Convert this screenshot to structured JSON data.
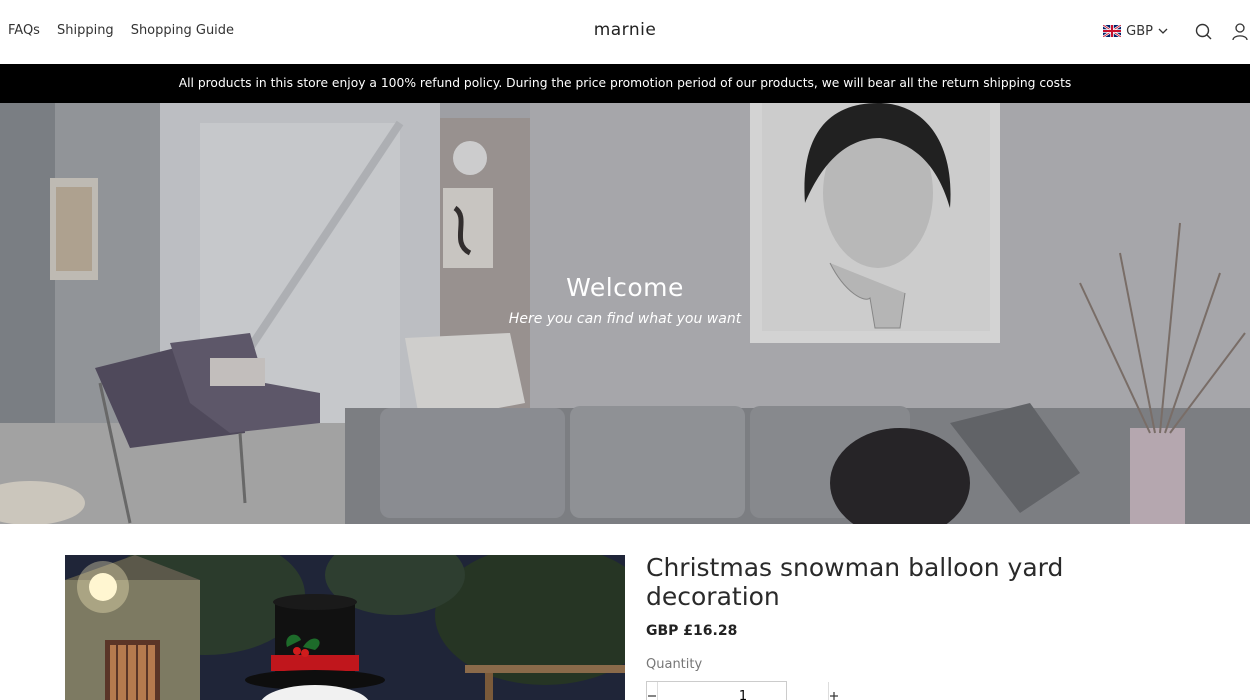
{
  "header": {
    "nav": [
      "FAQs",
      "Shipping",
      "Shopping Guide"
    ],
    "brand": "marnie",
    "currency": "GBP"
  },
  "announcement": "All products in this store enjoy a 100% refund policy. During the price promotion period of our products, we will bear all the return shipping costs",
  "hero": {
    "title": "Welcome",
    "subtitle": "Here you can find what you want"
  },
  "product": {
    "title": "Christmas snowman balloon yard decoration",
    "price": "GBP £16.28",
    "quantity_label": "Quantity",
    "quantity_value": "1"
  },
  "icons": {
    "flag": "uk-flag-icon",
    "currency_chevron": "chevron-down-icon",
    "search": "search-icon",
    "account": "user-icon"
  }
}
